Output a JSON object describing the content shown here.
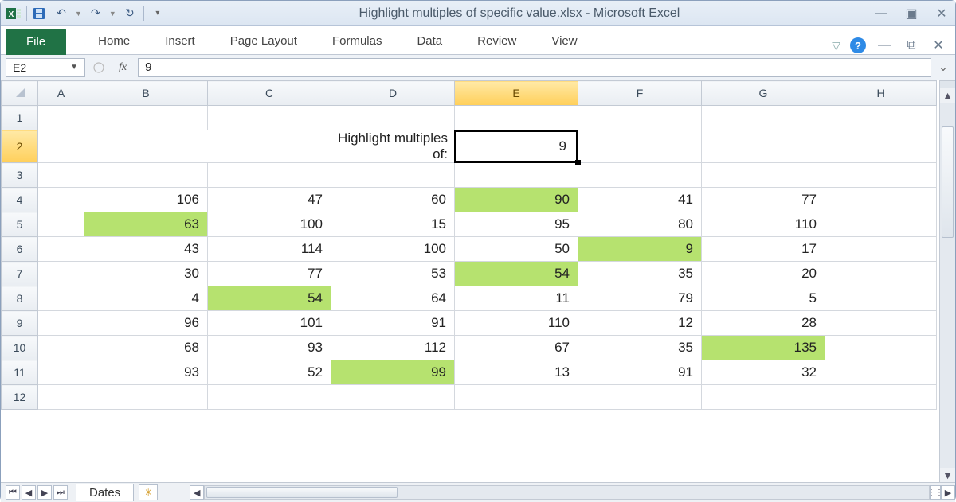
{
  "titlebar": {
    "document": "Highlight multiples of specific value.xlsx",
    "app": "Microsoft Excel",
    "sep": "  -  "
  },
  "qat": {
    "save": "💾",
    "undo": "↶",
    "redo": "↷",
    "refresh": "↻",
    "customize": "▾"
  },
  "ribbon": {
    "file": "File",
    "tabs": [
      "Home",
      "Insert",
      "Page Layout",
      "Formulas",
      "Data",
      "Review",
      "View"
    ],
    "collapse": "▽",
    "help": "?",
    "min": "—",
    "restore": "⧉",
    "close": "✕"
  },
  "formula_bar": {
    "name_box": "E2",
    "fx": "fx",
    "value": "9"
  },
  "columns": [
    "A",
    "B",
    "C",
    "D",
    "E",
    "F",
    "G",
    "H"
  ],
  "selected_col": "E",
  "selected_row": "2",
  "rows_shown": [
    "1",
    "2",
    "3",
    "4",
    "5",
    "6",
    "7",
    "8",
    "9",
    "10",
    "11",
    "12"
  ],
  "label_cell": {
    "row": "2",
    "text": "Highlight multiples of:"
  },
  "active_cell": {
    "row": "2",
    "col": "E",
    "value": "9"
  },
  "data_start_row": "4",
  "data_cols": [
    "B",
    "C",
    "D",
    "E",
    "F",
    "G"
  ],
  "data": [
    [
      106,
      47,
      60,
      90,
      41,
      77
    ],
    [
      63,
      100,
      15,
      95,
      80,
      110
    ],
    [
      43,
      114,
      100,
      50,
      9,
      17
    ],
    [
      30,
      77,
      53,
      54,
      35,
      20
    ],
    [
      4,
      54,
      64,
      11,
      79,
      5
    ],
    [
      96,
      101,
      91,
      110,
      12,
      28
    ],
    [
      68,
      93,
      112,
      67,
      35,
      135
    ],
    [
      93,
      52,
      99,
      13,
      91,
      32
    ]
  ],
  "highlight_cells": [
    {
      "r": 0,
      "c": 3
    },
    {
      "r": 1,
      "c": 0
    },
    {
      "r": 2,
      "c": 4
    },
    {
      "r": 3,
      "c": 3
    },
    {
      "r": 4,
      "c": 1
    },
    {
      "r": 6,
      "c": 5
    },
    {
      "r": 7,
      "c": 2
    }
  ],
  "sheet_tabs": {
    "active": "Dates"
  },
  "win": {
    "min": "—",
    "restore": "▣",
    "close": "✕"
  }
}
